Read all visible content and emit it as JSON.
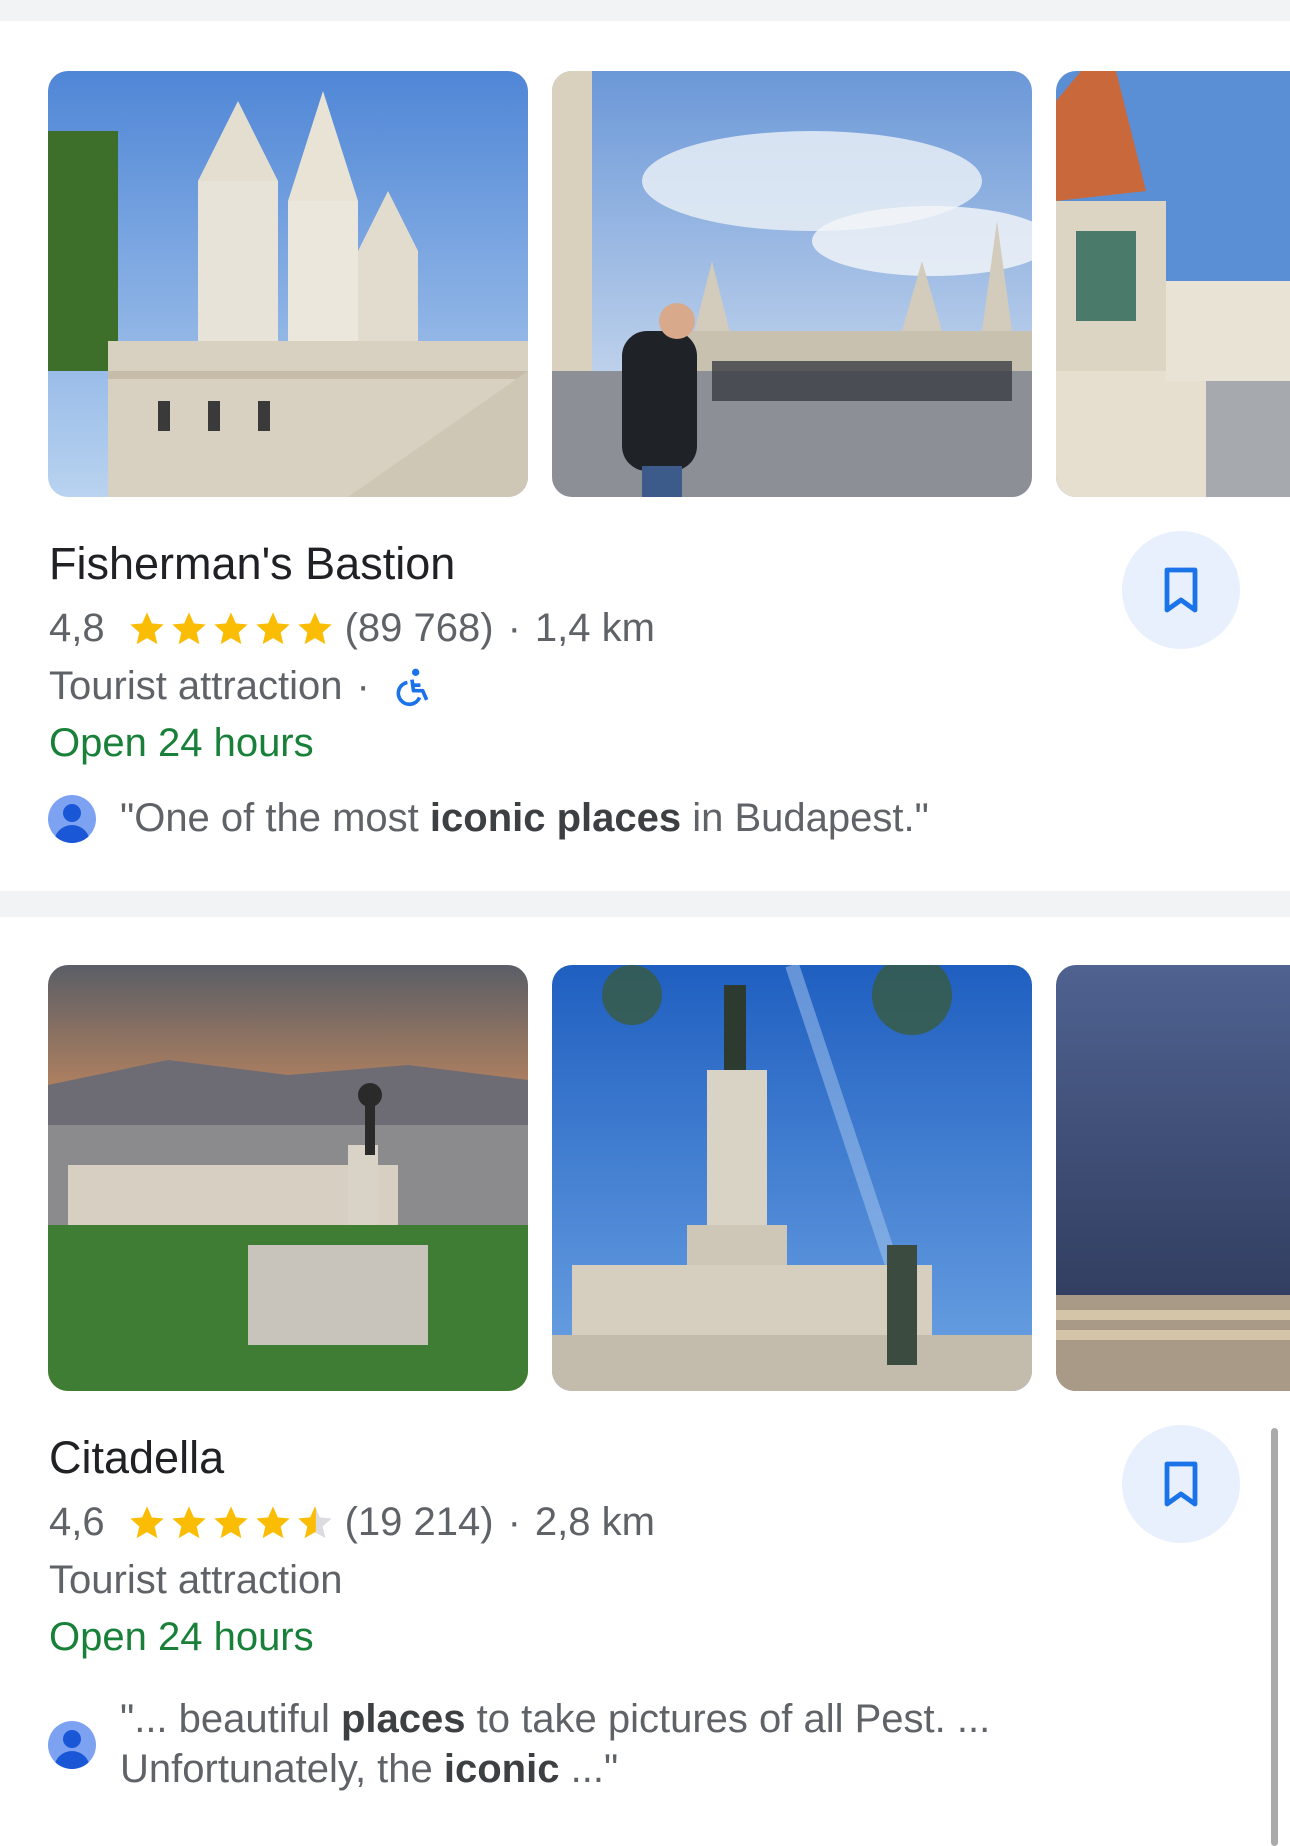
{
  "colors": {
    "divider": "#f1f3f4",
    "star": "#fbbc04",
    "open": "#188038",
    "save_bg": "#e8f0fe",
    "accent": "#1a73e8"
  },
  "places": [
    {
      "name": "Fisherman's Bastion",
      "rating": "4,8",
      "rating_value": 4.8,
      "stars": [
        "full",
        "full",
        "full",
        "full",
        "full"
      ],
      "reviews_count": "(89 768)",
      "separator": "·",
      "distance": "1,4 km",
      "category": "Tourist attraction",
      "accessibility_icon": "wheelchair-accessible-icon",
      "hours": "Open 24 hours",
      "review": {
        "prefix": "\"One of the most ",
        "bold1": "iconic places",
        "middle": " in Budapest.\"",
        "bold2": "",
        "suffix": ""
      }
    },
    {
      "name": "Citadella",
      "rating": "4,6",
      "rating_value": 4.6,
      "stars": [
        "full",
        "full",
        "full",
        "full",
        "half"
      ],
      "reviews_count": "(19 214)",
      "separator": "·",
      "distance": "2,8 km",
      "category": "Tourist attraction",
      "hours": "Open 24 hours",
      "review": {
        "prefix": "\"... beautiful ",
        "bold1": "places",
        "middle": " to take pictures of all Pest. ... Unfortunately, the ",
        "bold2": "iconic",
        "suffix": " ...\""
      }
    }
  ],
  "icons": {
    "save": "bookmark-icon",
    "reviewer": "user-avatar-icon",
    "star": "star-icon"
  }
}
